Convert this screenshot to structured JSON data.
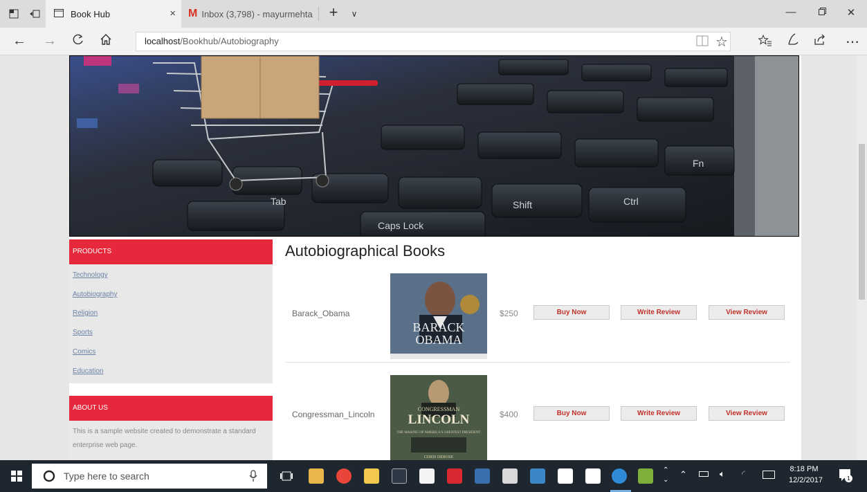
{
  "browser": {
    "tabs": [
      {
        "title": "Book Hub",
        "close": "×"
      },
      {
        "title": "Inbox (3,798) - mayurmehta"
      }
    ],
    "new_tab": "+",
    "tab_menu": "∨",
    "url_host": "localhost",
    "url_path": "/Bookhub/Autobiography"
  },
  "sidebar": {
    "products_title": "PRODUCTS",
    "categories": [
      "Technology",
      "Autobiography",
      "Religion",
      "Sports",
      "Comics",
      "Education"
    ],
    "about_title": "ABOUT US",
    "about_text": "This is a sample website created to demonstrate a standard enterprise web page."
  },
  "main": {
    "heading": "Autobiographical Books",
    "books": [
      {
        "name": "Barack_Obama",
        "price": "$250",
        "cover_title_1": "BARACK",
        "cover_title_2": "OBAMA",
        "buy": "Buy Now",
        "write": "Write Review",
        "view": "View Review"
      },
      {
        "name": "Congressman_Lincoln",
        "price": "$400",
        "cover_small": "CONGRESSMAN",
        "cover_title": "LINCOLN",
        "cover_sub": "THE MAKING OF AMERICA'S GREATEST PRESIDENT",
        "cover_author": "CHRIS DEROSE",
        "buy": "Buy Now",
        "write": "Write Review",
        "view": "View Review"
      }
    ]
  },
  "taskbar": {
    "search_placeholder": "Type here to search",
    "time": "8:18 PM",
    "date": "12/2/2017",
    "notification_count": "1"
  },
  "colors": {
    "accent_red": "#e5283b",
    "link": "#6b82a6",
    "button_text": "#c0312b",
    "taskbar": "#1e2630"
  }
}
